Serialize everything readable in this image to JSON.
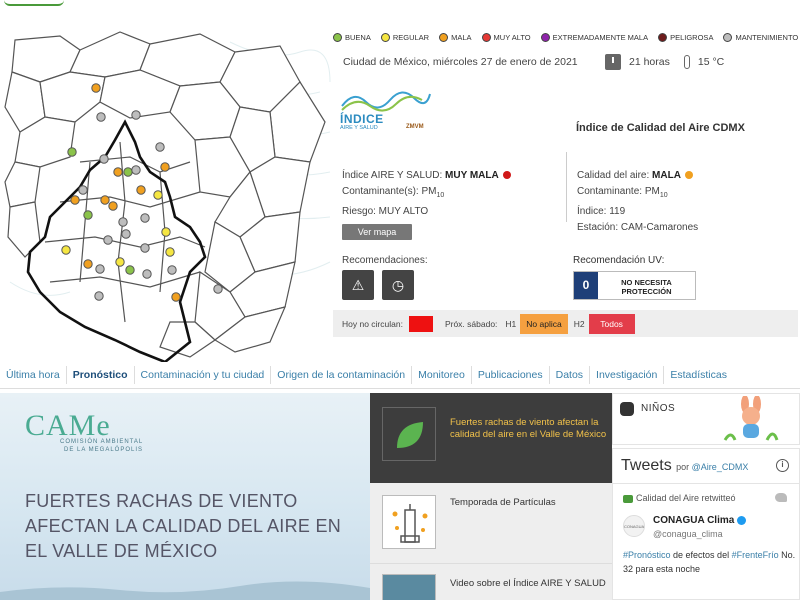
{
  "legend": [
    {
      "label": "BUENA",
      "color": "#8bc34a"
    },
    {
      "label": "REGULAR",
      "color": "#f5e642"
    },
    {
      "label": "MALA",
      "color": "#f0a020"
    },
    {
      "label": "MUY ALTO",
      "color": "#e53935"
    },
    {
      "label": "EXTREMADAMENTE MALA",
      "color": "#8e24aa"
    },
    {
      "label": "PELIGROSA",
      "color": "#6d1b1b"
    },
    {
      "label": "MANTENIMIENTO",
      "color": "#bdbdbd"
    }
  ],
  "header": {
    "date": "Ciudad de México, miércoles 27 de enero de 2021",
    "time": "21 horas",
    "temperature": "15 °C"
  },
  "logo": {
    "line1": "ÍNDICE",
    "line2": "AIRE Y SALUD",
    "line3": "ZMVM"
  },
  "panel_title": "Índice de Calidad del Aire CDMX",
  "aire_salud": {
    "indice_label": "Índice AIRE Y SALUD:",
    "indice_value": "MUY MALA",
    "contaminante_label": "Contaminante(s):",
    "contaminante_value": "PM",
    "contaminante_sub": "10",
    "riesgo": "Riesgo: MUY ALTO",
    "ver_mapa": "Ver mapa"
  },
  "calidad": {
    "calidad_label": "Calidad del aire:",
    "calidad_value": "MALA",
    "contaminante_label": "Contaminante:",
    "contaminante_value": "PM",
    "contaminante_sub": "10",
    "indice": "Índice: 119",
    "estacion": "Estación: CAM-Camarones"
  },
  "recomendaciones": {
    "title": "Recomendaciones:",
    "icons": [
      "caution-outdoor-activity-icon",
      "cycling-clock-icon"
    ]
  },
  "uv": {
    "title": "Recomendación UV:",
    "value": "0",
    "text_line1": "NO NECESITA",
    "text_line2": "PROTECCIÓN"
  },
  "circulacion": {
    "hoy_label": "Hoy no circulan:",
    "hoy_value": "",
    "sabado_label": "Próx. sábado:",
    "h1_label": "H1",
    "h1_value": "No aplica",
    "h2_label": "H2",
    "h2_value": "Todos"
  },
  "nav": [
    "Última hora",
    "Pronóstico",
    "Contaminación y tu ciudad",
    "Origen de la contaminación",
    "Monitoreo",
    "Publicaciones",
    "Datos",
    "Investigación",
    "Estadísticas"
  ],
  "nav_active": "Pronóstico",
  "hero": {
    "logo": "CAMe",
    "logo_sub1": "COMISIÓN AMBIENTAL",
    "logo_sub2": "DE LA MEGALÓPOLIS",
    "headline": "FUERTES RACHAS DE VIENTO AFECTAN LA CALIDAD DEL AIRE EN EL VALLE DE MÉXICO"
  },
  "news": [
    {
      "title": "Fuertes rachas de viento afectan la calidad del aire en el Valle de México",
      "icon": "leaf-icon"
    },
    {
      "title": "Temporada de Partículas",
      "icon": "building-particles-icon"
    },
    {
      "title": "Video sobre el Índice AIRE Y SALUD",
      "icon": "video-thumbnail-icon"
    }
  ],
  "ninos": {
    "label": "NIÑOS"
  },
  "tweets": {
    "title": "Tweets",
    "by": "por",
    "account": "@Aire_CDMX",
    "retweet": "Calidad del Aire retwitteó",
    "user": "CONAGUA Clima",
    "handle": "@conagua_clima",
    "avatar_text": "CONAGUA",
    "body_tag1": "#Pronóstico",
    "body_mid": " de efectos del ",
    "body_tag2": "#FrenteFrío",
    "body_end": " No. 32 para esta noche"
  },
  "map_stations": [
    {
      "status": "MALA"
    },
    {
      "status": "MANTENIMIENTO"
    },
    {
      "status": "MANTENIMIENTO"
    },
    {
      "status": "BUENA"
    },
    {
      "status": "MANTENIMIENTO"
    },
    {
      "status": "MANTENIMIENTO"
    },
    {
      "status": "MALA"
    },
    {
      "status": "MALA"
    },
    {
      "status": "BUENA"
    },
    {
      "status": "MANTENIMIENTO"
    },
    {
      "status": "REGULAR"
    },
    {
      "status": "MALA"
    },
    {
      "status": "MALA"
    },
    {
      "status": "MALA"
    },
    {
      "status": "MANTENIMIENTO"
    },
    {
      "status": "BUENA"
    },
    {
      "status": "MALA"
    },
    {
      "status": "MANTENIMIENTO"
    },
    {
      "status": "MANTENIMIENTO"
    },
    {
      "status": "REGULAR"
    },
    {
      "status": "MANTENIMIENTO"
    },
    {
      "status": "MANTENIMIENTO"
    },
    {
      "status": "MANTENIMIENTO"
    },
    {
      "status": "REGULAR"
    },
    {
      "status": "MALA"
    },
    {
      "status": "REGULAR"
    },
    {
      "status": "MANTENIMIENTO"
    },
    {
      "status": "BUENA"
    },
    {
      "status": "MANTENIMIENTO"
    },
    {
      "status": "MANTENIMIENTO"
    },
    {
      "status": "MANTENIMIENTO"
    },
    {
      "status": "MALA"
    },
    {
      "status": "MANTENIMIENTO"
    },
    {
      "status": "REGULAR"
    }
  ]
}
